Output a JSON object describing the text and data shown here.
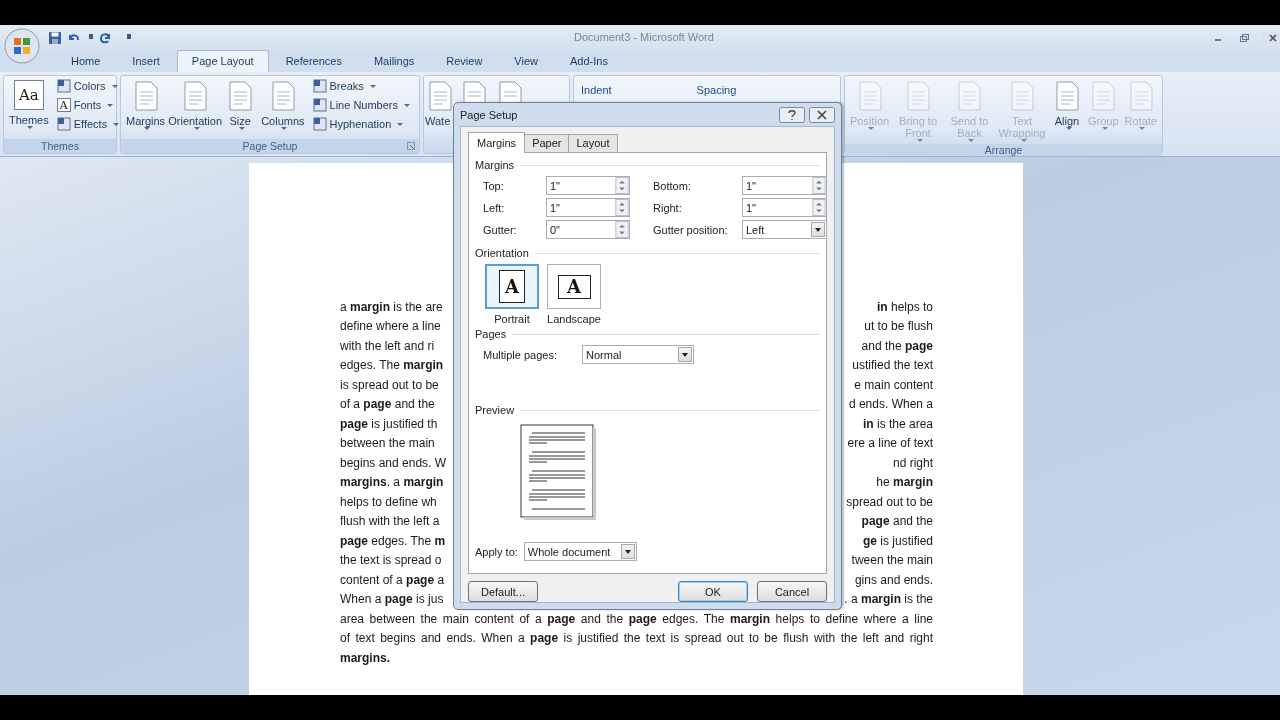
{
  "window": {
    "title": "Document3 - Microsoft Word"
  },
  "tabs": [
    {
      "label": "Home",
      "selected": false
    },
    {
      "label": "Insert",
      "selected": false
    },
    {
      "label": "Page Layout",
      "selected": true
    },
    {
      "label": "References",
      "selected": false
    },
    {
      "label": "Mailings",
      "selected": false
    },
    {
      "label": "Review",
      "selected": false
    },
    {
      "label": "View",
      "selected": false
    },
    {
      "label": "Add-Ins",
      "selected": false
    }
  ],
  "ribbon": {
    "groups": [
      {
        "label": "Themes",
        "launcher": false,
        "items": [
          {
            "kind": "large",
            "label": "Themes",
            "glyph": "Aa",
            "dropdown": true,
            "disabled": false
          },
          {
            "kind": "small",
            "label": "Colors",
            "dropdown": true,
            "disabled": false
          },
          {
            "kind": "small",
            "label": "Fonts",
            "glyph": "A",
            "dropdown": true,
            "disabled": false
          },
          {
            "kind": "small",
            "label": "Effects",
            "dropdown": true,
            "disabled": false
          }
        ]
      },
      {
        "label": "Page Setup",
        "launcher": true,
        "items": [
          {
            "kind": "large",
            "label": "Margins",
            "dropdown": true,
            "disabled": false
          },
          {
            "kind": "large",
            "label": "Orientation",
            "dropdown": true,
            "disabled": false
          },
          {
            "kind": "large",
            "label": "Size",
            "dropdown": true,
            "disabled": false
          },
          {
            "kind": "large",
            "label": "Columns",
            "dropdown": true,
            "disabled": false
          },
          {
            "kind": "small",
            "label": "Breaks",
            "dropdown": true,
            "disabled": false
          },
          {
            "kind": "small",
            "label": "Line Numbers",
            "dropdown": true,
            "disabled": false
          },
          {
            "kind": "small",
            "label": "Hyphenation",
            "dropdown": true,
            "disabled": false
          }
        ]
      },
      {
        "launcher": false,
        "items": [
          {
            "kind": "large",
            "label": "Wate",
            "dropdown": false,
            "disabled": false
          },
          {
            "kind": "icon",
            "disabled": false
          },
          {
            "kind": "icon",
            "disabled": false
          }
        ]
      },
      {
        "launcher": false,
        "items": [
          {
            "kind": "heading",
            "label": "Indent"
          },
          {
            "kind": "heading",
            "label": "Spacing"
          }
        ]
      },
      {
        "label": "Arrange",
        "launcher": false,
        "items": [
          {
            "kind": "large",
            "label": "Position",
            "dropdown": true,
            "disabled": true
          },
          {
            "kind": "large",
            "label": "Bring to Front",
            "dropdown": true,
            "disabled": true
          },
          {
            "kind": "large",
            "label": "Send to Back",
            "dropdown": true,
            "disabled": true
          },
          {
            "kind": "large",
            "label": "Text Wrapping",
            "dropdown": true,
            "disabled": true
          },
          {
            "kind": "large",
            "label": "Align",
            "dropdown": true,
            "disabled": false
          },
          {
            "kind": "large",
            "label": "Group",
            "dropdown": true,
            "disabled": true
          },
          {
            "kind": "large",
            "label": "Rotate",
            "dropdown": true,
            "disabled": true
          }
        ]
      }
    ]
  },
  "document": {
    "lines": [
      {
        "kind": "split",
        "left": "a **margin** is the are",
        "right": "**in** helps to"
      },
      {
        "kind": "split",
        "left": "define where a line",
        "right": "ut to be flush"
      },
      {
        "kind": "split",
        "left": "with the left and ri",
        "right": "and the **page**"
      },
      {
        "kind": "split",
        "left": "edges. The **margin**",
        "right": "ustified the text"
      },
      {
        "kind": "split",
        "left": "is spread out to be",
        "right": "e main content"
      },
      {
        "kind": "split",
        "left": "of a **page** and the",
        "right": "d ends. When a"
      },
      {
        "kind": "split",
        "left": "**page** is justified th",
        "right": "**in** is the area"
      },
      {
        "kind": "split",
        "left": "between the main",
        "right": "ere a line of text"
      },
      {
        "kind": "split",
        "left": "begins and ends. W",
        "right": "nd right"
      },
      {
        "kind": "split",
        "left": "**margins**. a **margin**",
        "right": "he **margin**"
      },
      {
        "kind": "split",
        "left": "helps to define wh",
        "right": "spread out to be"
      },
      {
        "kind": "split",
        "left": "flush with the left a",
        "right": "**page** and the"
      },
      {
        "kind": "split",
        "left": "**page** edges. The **m**",
        "right": "**ge** is justified"
      },
      {
        "kind": "split",
        "left": "the text is spread o",
        "right": "tween the main"
      },
      {
        "kind": "split",
        "left": "content of a **page** a",
        "right": "gins and ends."
      },
      {
        "kind": "split",
        "left": "When a **page** is jus",
        "right": ". a **margin** is the"
      },
      {
        "kind": "full",
        "text": "area between the main content of a **page** and the **page** edges. The **margin** helps to define where a line"
      },
      {
        "kind": "full",
        "text": "of text begins and ends. When a **page** is justified the text is spread out to be flush with the left and right"
      },
      {
        "kind": "last",
        "text": "**margins.**"
      }
    ]
  },
  "dialog": {
    "title": "Page Setup",
    "tabs": [
      {
        "label": "Margins",
        "selected": true
      },
      {
        "label": "Paper",
        "selected": false
      },
      {
        "label": "Layout",
        "selected": false
      }
    ],
    "margins_heading": "Margins",
    "margin_fields": [
      {
        "label": "Top:",
        "value": "1\"",
        "kind": "spin"
      },
      {
        "label": "Bottom:",
        "value": "1\"",
        "kind": "spin"
      },
      {
        "label": "Left:",
        "value": "1\"",
        "kind": "spin"
      },
      {
        "label": "Right:",
        "value": "1\"",
        "kind": "spin"
      },
      {
        "label": "Gutter:",
        "value": "0\"",
        "kind": "spin"
      },
      {
        "label": "Gutter position:",
        "value": "Left",
        "kind": "dropdown"
      }
    ],
    "orientation_heading": "Orientation",
    "orientations": [
      {
        "label": "Portrait",
        "glyph": "A",
        "selected": true
      },
      {
        "label": "Landscape",
        "glyph": "A",
        "selected": false
      }
    ],
    "pages_heading": "Pages",
    "multiple_pages": {
      "label": "Multiple pages:",
      "value": "Normal"
    },
    "preview_heading": "Preview",
    "apply_to": {
      "label": "Apply to:",
      "value": "Whole document"
    },
    "buttons": [
      {
        "label": "Default...",
        "default": false
      },
      {
        "label": "OK",
        "default": true
      },
      {
        "label": "Cancel",
        "default": false
      }
    ]
  }
}
